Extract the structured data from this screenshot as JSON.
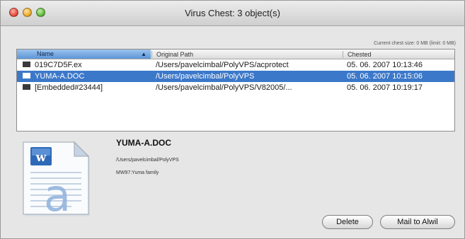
{
  "window": {
    "title": "Virus Chest: 3 object(s)"
  },
  "cache_info": "Current chest size: 0 MB (limit: 0 MB)",
  "table": {
    "columns": {
      "name": "Name",
      "path": "Original Path",
      "date": "Chested"
    },
    "rows": [
      {
        "name": "019C7D5F.ex",
        "path": "/Users/pavelcimbal/PolyVPS/acprotect",
        "date": "05. 06. 2007 10:13:46",
        "selected": false
      },
      {
        "name": "YUMA-A.DOC",
        "path": "/Users/pavelcimbal/PolyVPS",
        "date": "05. 06. 2007 10:15:06",
        "selected": true
      },
      {
        "name": "[Embedded#23444]",
        "path": "/Users/pavelcimbal/PolyVPS/V82005/...",
        "date": "05. 06. 2007 10:19:17",
        "selected": false
      }
    ]
  },
  "details": {
    "title": "YUMA-A.DOC",
    "path": "/Users/pavelcimbal/PolyVPS",
    "description": "MW97:Yuma family"
  },
  "buttons": {
    "delete": "Delete",
    "mail": "Mail to Alwil"
  },
  "colors": {
    "selection": "#3c78c9",
    "header_sort": "#5d95d6"
  },
  "icons": {
    "file_row": "file-icon",
    "preview": "word-document-icon",
    "sort": "sort-arrow-icon"
  }
}
